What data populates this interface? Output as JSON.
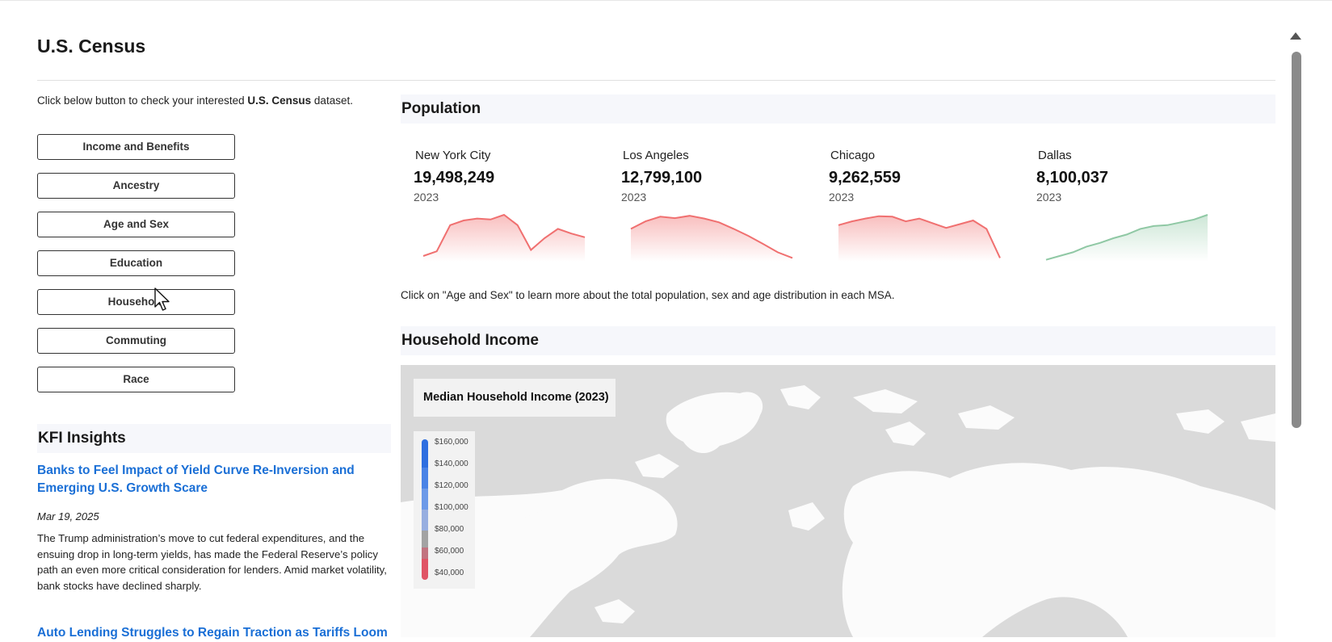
{
  "page": {
    "title": "U.S. Census"
  },
  "intro": {
    "prefix": "Click below button to check your interested ",
    "bold": "U.S. Census",
    "suffix": " dataset."
  },
  "dataset_buttons": [
    "Income and Benefits",
    "Ancestry",
    "Age and Sex",
    "Education",
    "Household",
    "Commuting",
    "Race"
  ],
  "kfi": {
    "heading": "KFI Insights",
    "articles": [
      {
        "title": "Banks to Feel Impact of Yield Curve Re-Inversion and Emerging U.S. Growth Scare",
        "date": "Mar 19, 2025",
        "body": "The Trump administration’s move to cut federal expenditures, and the ensuing drop in long-term yields, has made the Federal Reserve’s policy path an even more critical consideration for lenders. Amid market volatility, bank stocks have declined sharply."
      },
      {
        "title": "Auto Lending Struggles to Regain Traction as Tariffs Loom"
      }
    ]
  },
  "population": {
    "heading": "Population",
    "metrics": [
      {
        "city": "New York City",
        "value": "19,498,249",
        "year": "2023",
        "trend": "down",
        "color": "#f07070",
        "spark": [
          0.12,
          0.22,
          0.78,
          0.88,
          0.92,
          0.9,
          1.0,
          0.78,
          0.25,
          0.5,
          0.7,
          0.6,
          0.52
        ]
      },
      {
        "city": "Los Angeles",
        "value": "12,799,100",
        "year": "2023",
        "trend": "down",
        "color": "#f07070",
        "spark": [
          0.7,
          0.86,
          0.96,
          0.93,
          0.98,
          0.92,
          0.84,
          0.7,
          0.55,
          0.38,
          0.2,
          0.08
        ]
      },
      {
        "city": "Chicago",
        "value": "9,262,559",
        "year": "2023",
        "trend": "down",
        "color": "#f07070",
        "spark": [
          0.78,
          0.86,
          0.92,
          0.97,
          0.96,
          0.86,
          0.92,
          0.82,
          0.72,
          0.8,
          0.88,
          0.7,
          0.08
        ]
      },
      {
        "city": "Dallas",
        "value": "8,100,037",
        "year": "2023",
        "trend": "up",
        "color": "#8fc8a4",
        "spark": [
          0.04,
          0.12,
          0.2,
          0.32,
          0.4,
          0.5,
          0.58,
          0.7,
          0.76,
          0.78,
          0.84,
          0.9,
          1.0
        ]
      }
    ],
    "note": "Click on \"Age and Sex\" to learn more about the total population, sex and age distribution in each MSA."
  },
  "household_income": {
    "heading": "Household Income",
    "map_title": "Median Household Income (2023)",
    "legend": [
      "$160,000",
      "$140,000",
      "$120,000",
      "$100,000",
      "$80,000",
      "$60,000",
      "$40,000"
    ],
    "legend_colors": [
      "#2f6fe0",
      "#4a83e6",
      "#6d9ae8",
      "#97aee0",
      "#a3a3a3",
      "#c27480",
      "#e05566"
    ]
  }
}
